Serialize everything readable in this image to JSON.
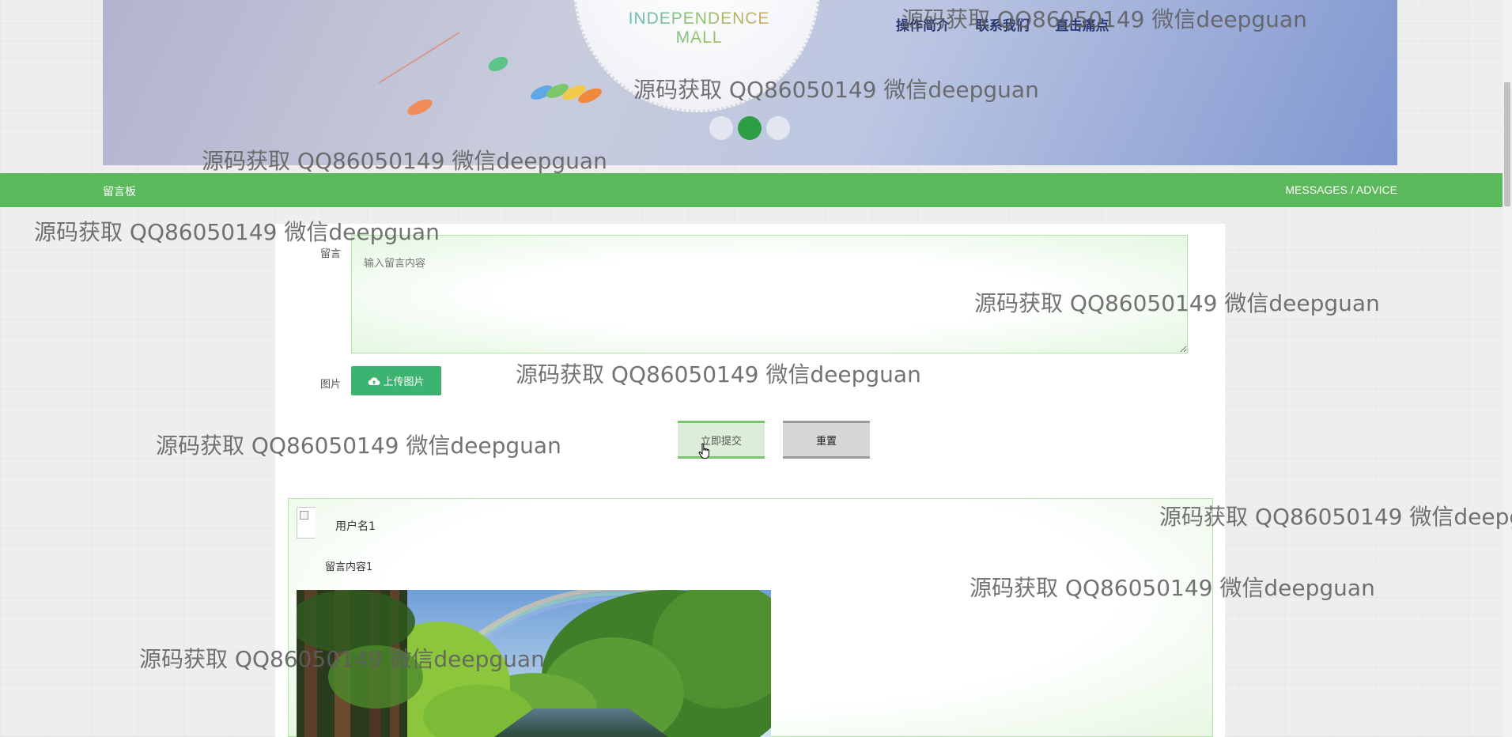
{
  "banner": {
    "mall_name": "INDEPENDENCE MALL",
    "nav_items": [
      "操作简介",
      "联系我们",
      "直击痛点"
    ],
    "slide_count": 3,
    "active_slide": 2
  },
  "section": {
    "title": "留言板",
    "subtitle": "MESSAGES / ADVICE"
  },
  "form": {
    "message_label": "留言",
    "message_placeholder": "输入留言内容",
    "image_label": "图片",
    "upload_button": "上传图片",
    "submit_button": "立即提交",
    "reset_button": "重置"
  },
  "messages": [
    {
      "username": "用户名1",
      "content": "留言内容1"
    }
  ],
  "watermark": "源码获取 QQ86050149 微信deepguan",
  "colors": {
    "accent_green": "#5cb85c",
    "upload_green": "#3cb371",
    "active_dot": "#2e9e46"
  }
}
